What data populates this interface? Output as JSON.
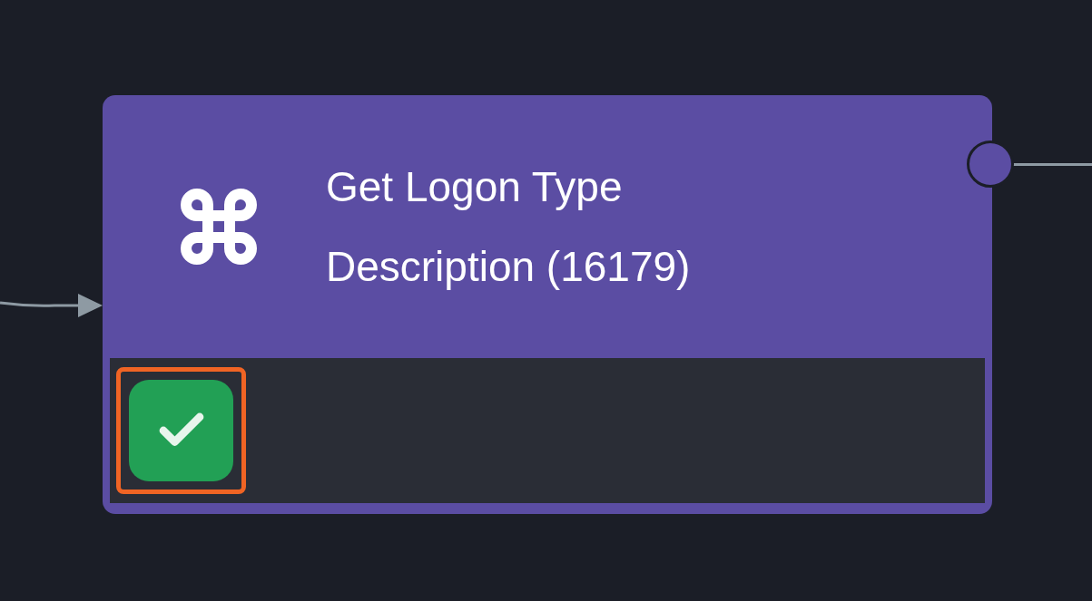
{
  "node": {
    "title": "Get Logon Type Description (16179)",
    "status": {
      "kind": "success",
      "selected": true
    }
  }
}
